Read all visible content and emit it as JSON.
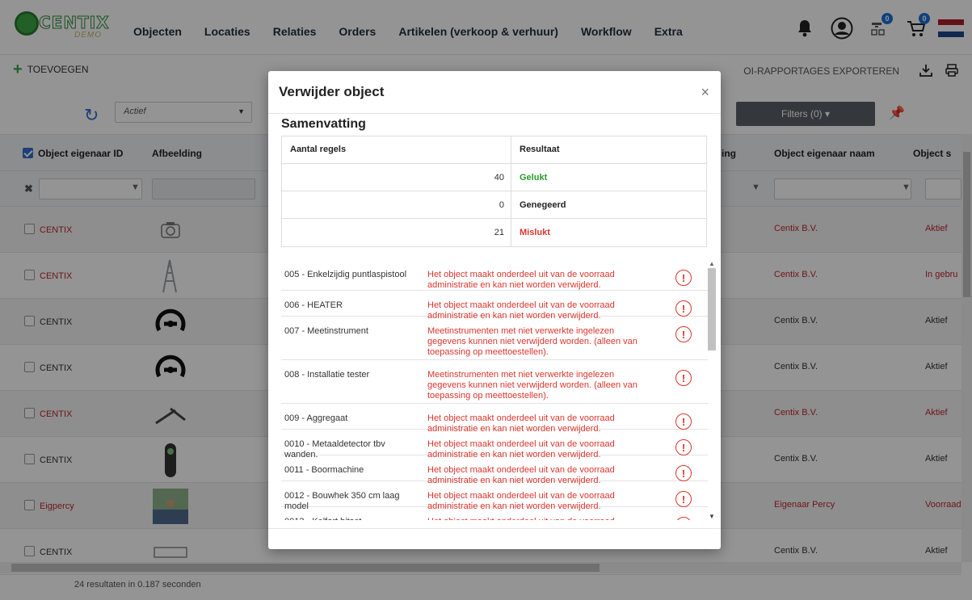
{
  "nav": {
    "links": [
      "Objecten",
      "Locaties",
      "Relaties",
      "Orders",
      "Artikelen (verkoop & verhuur)",
      "Workflow",
      "Extra"
    ],
    "logo_text": "CENTIX",
    "logo_sub": "DEMO",
    "badge_scan": "0",
    "badge_cart": "0"
  },
  "toolbar": {
    "add_label": "TOEVOEGEN",
    "export_label": "OI-RAPPORTAGES EXPORTEREN"
  },
  "filters": {
    "status_value": "Actief",
    "filters_button": "Filters (0) ▾"
  },
  "table": {
    "columns": [
      "Object eigenaar ID",
      "Afbeelding",
      "Object eigenaar naam",
      "Object s"
    ],
    "col_partial_ing": "ing",
    "rows": [
      {
        "owner_id": "CENTIX",
        "owner_name": "Centix B.V.",
        "status": "Aktief",
        "red": true,
        "thumb": "no-image"
      },
      {
        "owner_id": "CENTIX",
        "owner_name": "Centix B.V.",
        "status": "In gebru",
        "red": true,
        "thumb": "ladder"
      },
      {
        "owner_id": "CENTIX",
        "owner_name": "Centix B.V.",
        "status": "Aktief",
        "red": false,
        "thumb": "gauge"
      },
      {
        "owner_id": "CENTIX",
        "owner_name": "Centix B.V.",
        "status": "Aktief",
        "red": false,
        "thumb": "gauge"
      },
      {
        "owner_id": "CENTIX",
        "owner_name": "Centix B.V.",
        "status": "Aktief",
        "red": true,
        "thumb": "tool"
      },
      {
        "owner_id": "CENTIX",
        "owner_name": "Centix B.V.",
        "status": "Aktief",
        "red": false,
        "thumb": "detector"
      },
      {
        "owner_id": "Eigpercy",
        "owner_name": "Eigenaar Percy",
        "status": "Voorraad",
        "red": true,
        "thumb": "photo"
      },
      {
        "owner_id": "CENTIX",
        "owner_name": "Centix B.V.",
        "status": "Aktief",
        "red": false,
        "thumb": "fence"
      }
    ],
    "footer": "24 resultaten in 0.187 seconden",
    "no_image": "No image available"
  },
  "modal": {
    "title": "Verwijder object",
    "close": "×",
    "summary_title": "Samenvatting",
    "summary_headers": [
      "Aantal regels",
      "Resultaat"
    ],
    "summary_rows": [
      {
        "count": "40",
        "result": "Gelukt",
        "color": "#2e9a2e"
      },
      {
        "count": "0",
        "result": "Genegeerd",
        "color": "#222222"
      },
      {
        "count": "21",
        "result": "Mislukt",
        "color": "#d9362e"
      }
    ],
    "items": [
      {
        "name": "005 - Enkelzijdig puntlaspistool",
        "message": "Het object maakt onderdeel uit van de voorraad administratie en kan niet worden verwijderd.",
        "lines": 2
      },
      {
        "name": "006 - HEATER",
        "message": "Het object maakt onderdeel uit van de voorraad administratie en kan niet worden verwijderd.",
        "lines": 2
      },
      {
        "name": "007 - Meetinstrument",
        "message": "Meetinstrumenten met niet verwerkte ingelezen gegevens kunnen niet verwijderd worden. (alleen van toepassing op meettoestellen).",
        "lines": 3
      },
      {
        "name": "008 - Installatie tester",
        "message": "Meetinstrumenten met niet verwerkte ingelezen gegevens kunnen niet verwijderd worden. (alleen van toepassing op meettoestellen).",
        "lines": 3
      },
      {
        "name": "009 - Aggregaat",
        "message": "Het object maakt onderdeel uit van de voorraad administratie en kan niet worden verwijderd.",
        "lines": 2
      },
      {
        "name": "0010 - Metaaldetector tbv wanden.",
        "message": "Het object maakt onderdeel uit van de voorraad administratie en kan niet worden verwijderd.",
        "lines": 2
      },
      {
        "name": "0011 - Boormachine",
        "message": "Het object maakt onderdeel uit van de voorraad administratie en kan niet worden verwijderd.",
        "lines": 2
      },
      {
        "name": "0012 - Bouwhek 350 cm laag model",
        "message": "Het object maakt onderdeel uit van de voorraad administratie en kan niet worden verwijderd.",
        "lines": 2
      },
      {
        "name": "0013 - Kelfort bitset",
        "message": "Het object maakt onderdeel uit van de voorraad administratie en kan niet worden verwijderd.",
        "lines": 2
      }
    ],
    "item_icon": "!"
  },
  "colors": {
    "accent_blue": "#2f6fd1",
    "brand_green": "#3aa846",
    "error_red": "#d9362e",
    "success_green": "#2e9a2e"
  }
}
